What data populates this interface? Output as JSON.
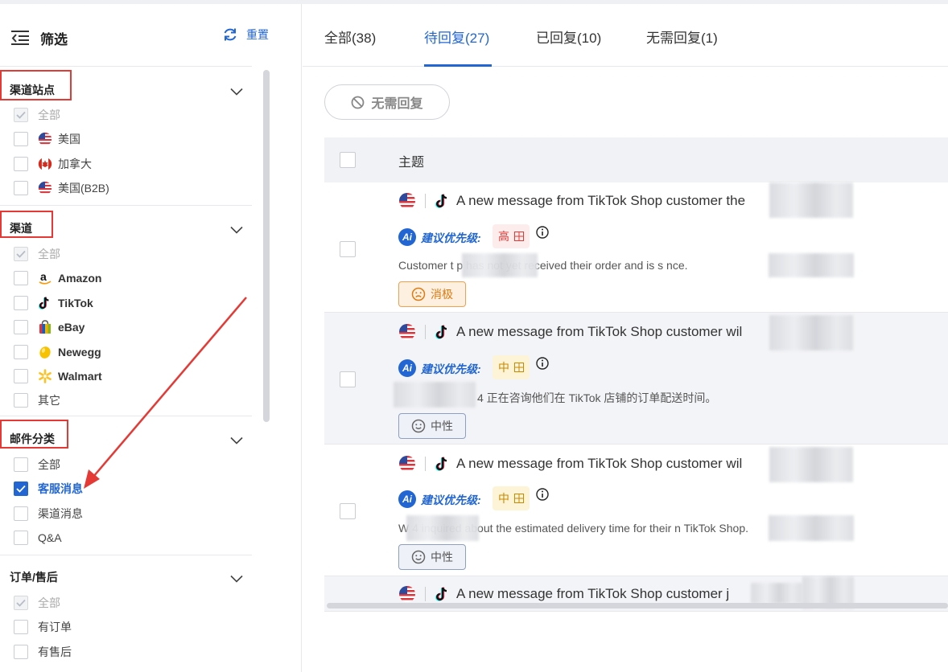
{
  "sidebar": {
    "title": "筛选",
    "reset_label": "重置",
    "sections": [
      {
        "title": "渠道站点",
        "options": [
          {
            "label": "全部",
            "icon": "",
            "state": "disabled-checked"
          },
          {
            "label": "美国",
            "icon": "us-flag-icon",
            "state": "unchecked"
          },
          {
            "label": "加拿大",
            "icon": "canada-flag-icon",
            "state": "unchecked"
          },
          {
            "label": "美国(B2B)",
            "icon": "us-flag-icon",
            "state": "unchecked"
          }
        ]
      },
      {
        "title": "渠道",
        "options": [
          {
            "label": "全部",
            "icon": "",
            "state": "disabled-checked"
          },
          {
            "label": "Amazon",
            "icon": "amazon-icon",
            "state": "unchecked"
          },
          {
            "label": "TikTok",
            "icon": "tiktok-icon",
            "state": "unchecked"
          },
          {
            "label": "eBay",
            "icon": "ebay-icon",
            "state": "unchecked"
          },
          {
            "label": "Newegg",
            "icon": "newegg-icon",
            "state": "unchecked"
          },
          {
            "label": "Walmart",
            "icon": "walmart-icon",
            "state": "unchecked"
          },
          {
            "label": "其它",
            "icon": "",
            "state": "unchecked"
          }
        ]
      },
      {
        "title": "邮件分类",
        "options": [
          {
            "label": "全部",
            "icon": "",
            "state": "unchecked"
          },
          {
            "label": "客服消息",
            "icon": "",
            "state": "checked"
          },
          {
            "label": "渠道消息",
            "icon": "",
            "state": "unchecked"
          },
          {
            "label": "Q&A",
            "icon": "",
            "state": "unchecked"
          }
        ]
      },
      {
        "title": "订单/售后",
        "options": [
          {
            "label": "全部",
            "icon": "",
            "state": "disabled-checked"
          },
          {
            "label": "有订单",
            "icon": "",
            "state": "unchecked"
          },
          {
            "label": "有售后",
            "icon": "",
            "state": "unchecked"
          }
        ]
      }
    ]
  },
  "tabs": [
    {
      "label": "全部(38)",
      "active": false
    },
    {
      "label": "待回复(27)",
      "active": true
    },
    {
      "label": "已回复(10)",
      "active": false
    },
    {
      "label": "无需回复(1)",
      "active": false
    }
  ],
  "toolbar": {
    "no_reply_label": "无需回复"
  },
  "table": {
    "header_subject": "主题",
    "priority_label": "建议优先级:",
    "rows": [
      {
        "subject": "A new message from TikTok Shop customer the",
        "priority": "高",
        "priority_level": "high",
        "summary": "Customer t            p has not yet received their order and is s                   nce.",
        "sentiment": "消极",
        "sentiment_type": "negative"
      },
      {
        "subject": "A new message from TikTok Shop customer wil",
        "priority": "中",
        "priority_level": "medium",
        "summary": "4 正在咨询他们在 TikTok 店铺的订单配送时间。",
        "sentiment": "中性",
        "sentiment_type": "neutral"
      },
      {
        "subject": "A new message from TikTok Shop customer wil",
        "priority": "中",
        "priority_level": "medium",
        "summary": "W              4 inquired about the estimated delivery time for their                  n TikTok Shop.",
        "sentiment": "中性",
        "sentiment_type": "neutral"
      },
      {
        "subject": "A new message from TikTok Shop customer j"
      }
    ]
  },
  "colors": {
    "accent": "#2266d4",
    "highlight_red": "#e53935",
    "priority_high": "#e53935",
    "priority_medium": "#c98a00",
    "negative": "#e07a10"
  }
}
